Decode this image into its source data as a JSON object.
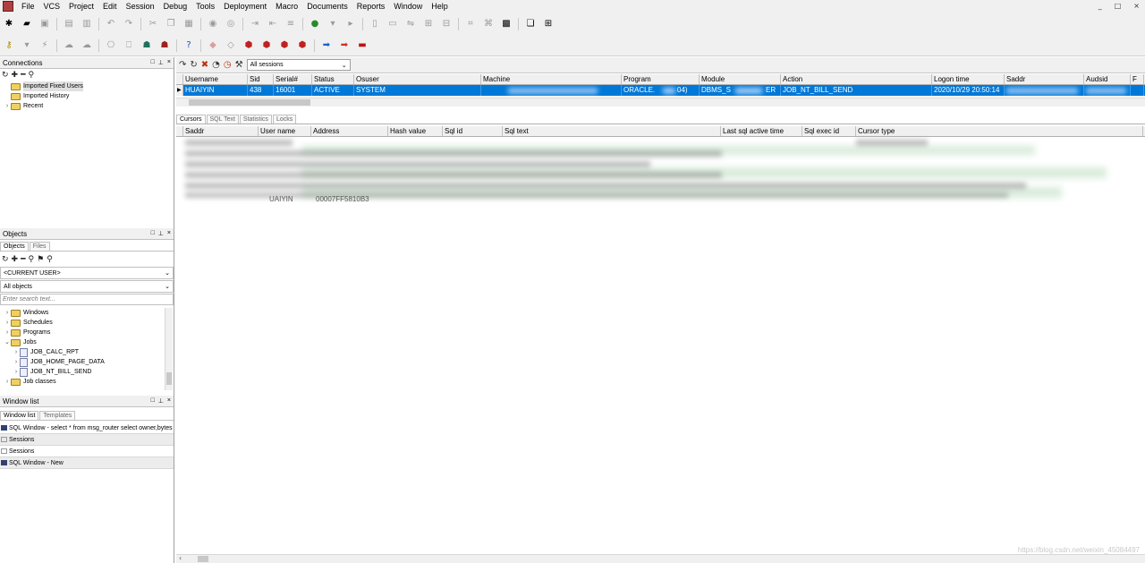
{
  "menu": [
    "File",
    "VCS",
    "Project",
    "Edit",
    "Session",
    "Debug",
    "Tools",
    "Deployment",
    "Macro",
    "Documents",
    "Reports",
    "Window",
    "Help"
  ],
  "window_controls": [
    "_",
    "□",
    "×"
  ],
  "connections": {
    "title": "Connections",
    "items": [
      {
        "label": "Imported Fixed Users"
      },
      {
        "label": "Imported History"
      },
      {
        "label": "Recent"
      }
    ]
  },
  "objects": {
    "title": "Objects",
    "tabs": [
      "Objects",
      "Files"
    ],
    "user_combo": "<CURRENT USER>",
    "filter_combo": "All objects",
    "search_placeholder": "Enter search text...",
    "tree": [
      {
        "label": "Windows"
      },
      {
        "label": "Schedules"
      },
      {
        "label": "Programs"
      },
      {
        "label": "Jobs",
        "children": [
          "JOB_CALC_RPT",
          "JOB_HOME_PAGE_DATA",
          "JOB_NT_BILL_SEND"
        ]
      },
      {
        "label": "Job classes"
      }
    ]
  },
  "window_list": {
    "title": "Window list",
    "tabs": [
      "Window list",
      "Templates"
    ],
    "items": [
      "SQL Window - select * from msg_router select owner,bytes",
      "Sessions",
      "Sessions",
      "SQL Window - New"
    ]
  },
  "session": {
    "filter": "All sessions",
    "columns": [
      "Username",
      "Sid",
      "Serial#",
      "Status",
      "Osuser",
      "Machine",
      "Program",
      "Module",
      "Action",
      "Logon time",
      "Saddr",
      "Audsid",
      "F"
    ],
    "row": {
      "username": "HUAIYIN",
      "sid": "438",
      "serial": "16001",
      "status": "ACTIVE",
      "osuser": "SYSTEM",
      "program_a": "ORACLE.",
      "program_b": "04)",
      "module_a": "DBMS_S",
      "module_b": "ER",
      "action": "JOB_NT_BILL_SEND",
      "logon_time": "2020/10/29 20:50:14"
    }
  },
  "detail": {
    "tabs": [
      "Cursors",
      "SQL Text",
      "Statistics",
      "Locks"
    ],
    "columns": [
      "Saddr",
      "User name",
      "Address",
      "Hash value",
      "Sql id",
      "Sql text",
      "Last sql active time",
      "Sql exec id",
      "Cursor type"
    ],
    "last_row_partial": {
      "user": "UAIYIN",
      "address": "00007FF5810B3"
    }
  },
  "watermark": "https://blog.csdn.net/weixin_45084497"
}
